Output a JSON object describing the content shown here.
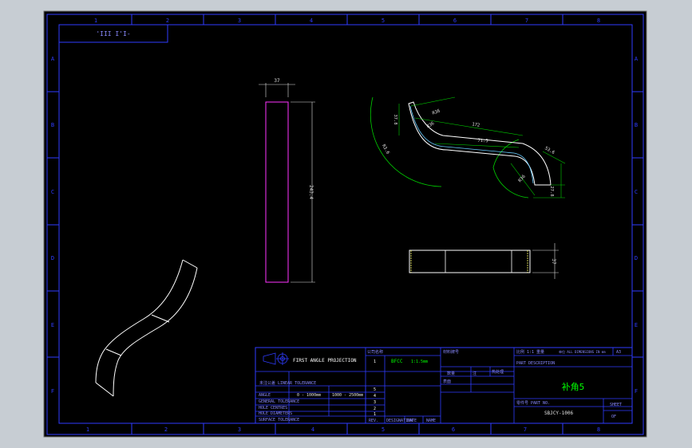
{
  "frame": {
    "top_columns": [
      "1",
      "2",
      "3",
      "4",
      "5",
      "6",
      "7",
      "8"
    ],
    "bottom_columns": [
      "1",
      "2",
      "3",
      "4",
      "5",
      "6",
      "7",
      "8"
    ],
    "left_rows": [
      "A",
      "B",
      "C",
      "D",
      "E",
      "F"
    ],
    "right_rows": [
      "A",
      "B",
      "C",
      "D",
      "E",
      "F"
    ]
  },
  "top_left_label": "'III I'I-",
  "dimensions": {
    "side_width": "37",
    "side_height": "243.4",
    "bottom_height": "37",
    "curve_top": "172",
    "curve_mid": "71.5",
    "curve_right_a": "53.6",
    "curve_right_b": "27.8",
    "curve_angle_a": "R36",
    "curve_angle_b": "R36",
    "curve_left_a": "37.8",
    "curve_left_b": "R3.6",
    "curve_rb": "R36"
  },
  "title_block": {
    "projection": "FIRST ANGLE PROJECTION",
    "company_label": "公司名称",
    "sheet_no": "1",
    "standard": "BFCC",
    "scale": "1:1.5mm",
    "material_label": "材料牌号",
    "count_label": "数量",
    "notes_label": "注",
    "treatment_label": "热处理",
    "coating_label": "表面",
    "tolerance_header": "未注公差 LINEAR TOLERANCE",
    "range_a": "0 - 1000mm",
    "range_b": "1000 - 2500mm",
    "row_angle": "ANGLE",
    "row_general": "GENERAL TOLERANCE",
    "row_hole": "HOLE CENTRES",
    "row_diam": "HOLE DIAMETERS",
    "row_surface": "SURFACE TOLERANCE",
    "row_marks": [
      "5",
      "4",
      "3",
      "2",
      "1"
    ],
    "rev_headers": [
      "REV.",
      "DESIGNATION",
      "DATE",
      "NAME"
    ],
    "right_top_a": "比例 1:1",
    "right_top_b": "重量",
    "right_top_c": "单位 ALL DIMENSIONS IN mm",
    "right_top_d": "A3",
    "part_desc_label": "PART DESCRIPTION",
    "part_title": "补角5",
    "part_no_label": "零件号 PART NO.",
    "part_no": "SBJCY-1006",
    "sheet_label": "SHEET",
    "of_label": "OF"
  }
}
